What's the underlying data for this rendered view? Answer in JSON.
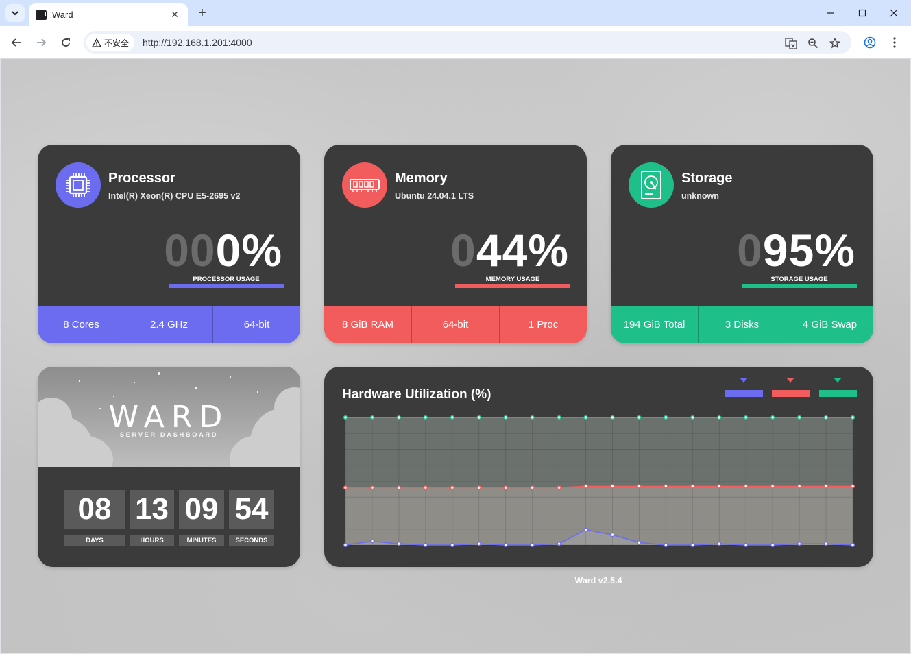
{
  "browser": {
    "tab_title": "Ward",
    "new_tab_label": "+",
    "security_label": "不安全",
    "url": "http://192.168.1.201:4000"
  },
  "processor": {
    "title": "Processor",
    "subtitle": "Intel(R) Xeon(R) CPU E5-2695 v2",
    "usage_dim": "00",
    "usage_value": "0%",
    "usage_label": "PROCESSOR USAGE",
    "stats": [
      "8 Cores",
      "2.4 GHz",
      "64-bit"
    ],
    "color": "#6c6cf0"
  },
  "memory": {
    "title": "Memory",
    "subtitle": "Ubuntu 24.04.1 LTS",
    "usage_dim": "0",
    "usage_value": "44%",
    "usage_label": "MEMORY USAGE",
    "stats": [
      "8 GiB RAM",
      "64-bit",
      "1 Proc"
    ],
    "color": "#f25c5c"
  },
  "storage": {
    "title": "Storage",
    "subtitle": "unknown",
    "usage_dim": "0",
    "usage_value": "95%",
    "usage_label": "STORAGE USAGE",
    "stats": [
      "194 GiB Total",
      "3 Disks",
      "4 GiB Swap"
    ],
    "color": "#1fbf8a"
  },
  "ward": {
    "title": "WARD",
    "subtitle": "SERVER DASHBOARD",
    "uptime": [
      {
        "value": "08",
        "label": "DAYS"
      },
      {
        "value": "13",
        "label": "HOURS"
      },
      {
        "value": "09",
        "label": "MINUTES"
      },
      {
        "value": "54",
        "label": "SECONDS"
      }
    ]
  },
  "chart_data": {
    "type": "area",
    "title": "Hardware Utilization (%)",
    "ylim": [
      0,
      100
    ],
    "grid": true,
    "legend": "top-right",
    "series": [
      {
        "color": "#6c6cf0",
        "values": [
          0,
          3,
          1,
          0,
          0,
          1,
          0,
          0,
          1,
          12,
          8,
          2,
          0,
          0,
          1,
          0,
          0,
          1,
          1,
          0
        ]
      },
      {
        "color": "#f25c5c",
        "values": [
          45,
          45,
          45,
          45,
          45,
          45,
          45,
          45,
          45,
          46,
          46,
          46,
          46,
          46,
          46,
          46,
          46,
          46,
          46,
          46
        ]
      },
      {
        "color": "#1fbf8a",
        "values": [
          100,
          100,
          100,
          100,
          100,
          100,
          100,
          100,
          100,
          100,
          100,
          100,
          100,
          100,
          100,
          100,
          100,
          100,
          100,
          100
        ]
      }
    ]
  },
  "footer": "Ward v2.5.4"
}
